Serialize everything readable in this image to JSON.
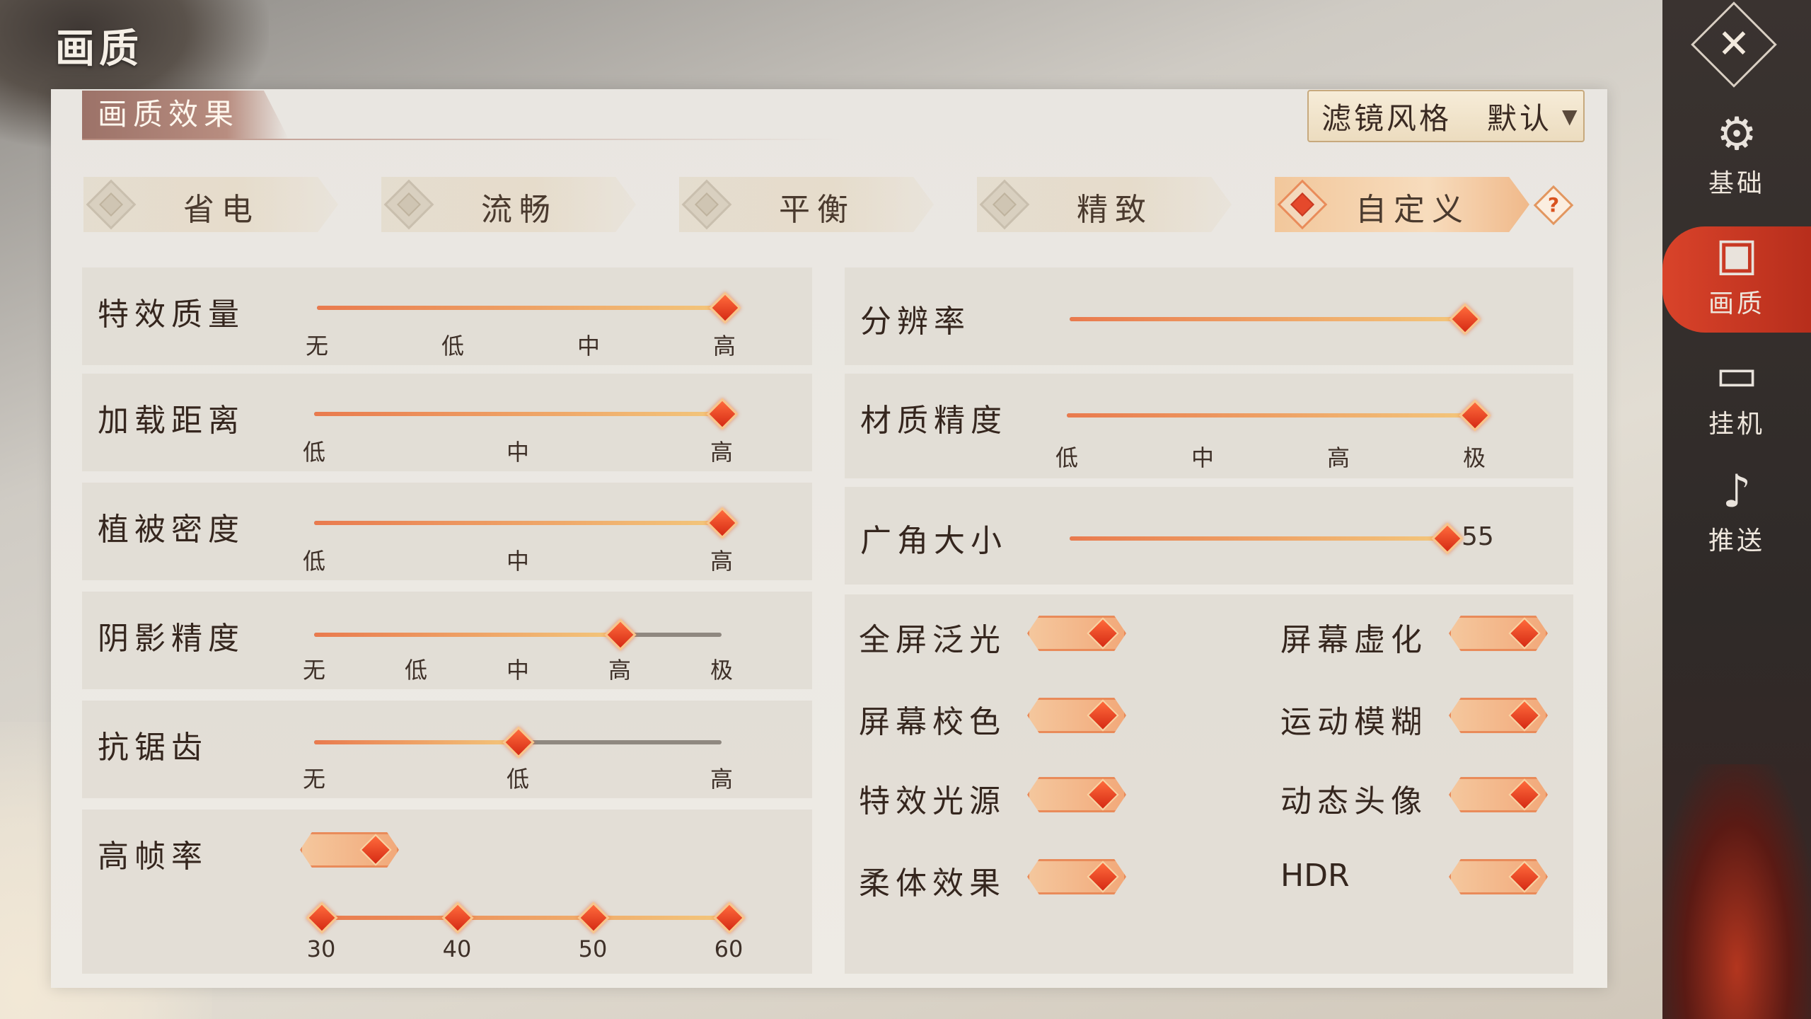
{
  "app": {
    "title": "画质"
  },
  "section": {
    "tab": "画质效果"
  },
  "filter": {
    "label": "滤镜风格",
    "value": "默认"
  },
  "presets": [
    {
      "label": "省电"
    },
    {
      "label": "流畅"
    },
    {
      "label": "平衡"
    },
    {
      "label": "精致"
    },
    {
      "label": "自定义",
      "active": true
    }
  ],
  "help": "?",
  "sliders": {
    "effects_quality": {
      "label": "特效质量",
      "ticks": [
        "无",
        "低",
        "中",
        "高"
      ],
      "value": "高",
      "level": 1.0
    },
    "load_distance": {
      "label": "加载距离",
      "ticks": [
        "低",
        "中",
        "高"
      ],
      "value": "高",
      "level": 1.0
    },
    "vegetation_density": {
      "label": "植被密度",
      "ticks": [
        "低",
        "中",
        "高"
      ],
      "value": "高",
      "level": 1.0
    },
    "shadow_quality": {
      "label": "阴影精度",
      "ticks": [
        "无",
        "低",
        "中",
        "高",
        "极"
      ],
      "value": "高",
      "level": 0.75
    },
    "anti_aliasing": {
      "label": "抗锯齿",
      "ticks": [
        "无",
        "低",
        "高"
      ],
      "value": "低",
      "level": 0.5
    },
    "resolution": {
      "label": "分辨率",
      "level": 1.0
    },
    "material_quality": {
      "label": "材质精度",
      "ticks": [
        "低",
        "中",
        "高",
        "极"
      ],
      "value": "极",
      "level": 1.0
    },
    "fov": {
      "label": "广角大小",
      "value": "55",
      "level": 1.0
    }
  },
  "high_fps": {
    "label": "高帧率",
    "on": true,
    "ticks": [
      "30",
      "40",
      "50",
      "60"
    ],
    "value": "60"
  },
  "toggles": {
    "fullscreen_bloom": {
      "label": "全屏泛光",
      "on": true
    },
    "screen_blur": {
      "label": "屏幕虚化",
      "on": true
    },
    "screen_color": {
      "label": "屏幕校色",
      "on": true
    },
    "motion_blur": {
      "label": "运动模糊",
      "on": true
    },
    "effect_light": {
      "label": "特效光源",
      "on": true
    },
    "dynamic_avatar": {
      "label": "动态头像",
      "on": true
    },
    "soft_body": {
      "label": "柔体效果",
      "on": true
    },
    "hdr": {
      "label": "HDR",
      "on": true
    }
  },
  "sidebar": [
    {
      "label": "基础",
      "icon": "gear-icon",
      "active": false
    },
    {
      "label": "画质",
      "icon": "image-icon",
      "active": true
    },
    {
      "label": "挂机",
      "icon": "monitor-icon",
      "active": false
    },
    {
      "label": "推送",
      "icon": "bell-icon",
      "active": false
    }
  ],
  "colors": {
    "accent": "#e5492c",
    "active_tab": "#c9341f",
    "panel": "#ebe8e3"
  }
}
